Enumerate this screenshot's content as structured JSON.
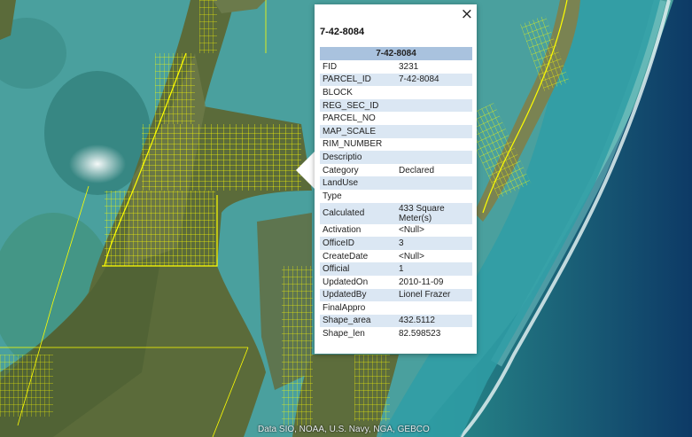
{
  "map": {
    "attribution": "Data SIO, NOAA, U.S. Navy, NGA, GEBCO",
    "parcel_color": "#ffff00",
    "water_color": "#4fa7a2",
    "deep_water_color": "#0f3d66",
    "land_color": "#5d6d3c"
  },
  "popup": {
    "title": "7-42-8084",
    "close_icon": "×",
    "header": "7-42-8084",
    "header_color": "#a9c2de",
    "stripe_color": "#dbe7f3",
    "rows": [
      {
        "key": "FID",
        "value": "3231"
      },
      {
        "key": "PARCEL_ID",
        "value": "7-42-8084"
      },
      {
        "key": "BLOCK",
        "value": ""
      },
      {
        "key": "REG_SEC_ID",
        "value": ""
      },
      {
        "key": "PARCEL_NO",
        "value": ""
      },
      {
        "key": "MAP_SCALE",
        "value": ""
      },
      {
        "key": "RIM_NUMBER",
        "value": ""
      },
      {
        "key": "Descriptio",
        "value": ""
      },
      {
        "key": "Category",
        "value": "Declared"
      },
      {
        "key": "LandUse",
        "value": ""
      },
      {
        "key": "Type",
        "value": ""
      },
      {
        "key": "Calculated",
        "value": "433 Square Meter(s)"
      },
      {
        "key": "Activation",
        "value": "<Null>"
      },
      {
        "key": "OfficeID",
        "value": "3"
      },
      {
        "key": "CreateDate",
        "value": "<Null>"
      },
      {
        "key": "Official",
        "value": "1"
      },
      {
        "key": "UpdatedOn",
        "value": "2010-11-09"
      },
      {
        "key": "UpdatedBy",
        "value": "Lionel Frazer"
      },
      {
        "key": "FinalAppro",
        "value": ""
      },
      {
        "key": "Shape_area",
        "value": "432.5112"
      },
      {
        "key": "Shape_len",
        "value": "82.598523"
      }
    ]
  }
}
